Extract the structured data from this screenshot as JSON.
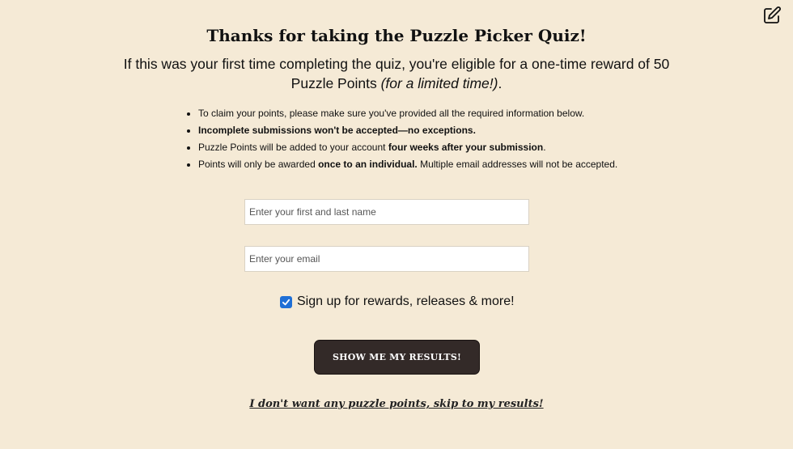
{
  "header": {
    "edit_icon": "edit-square-icon",
    "title": "Thanks for taking the Puzzle Picker Quiz!",
    "subtitle_main": "If this was your first time completing the quiz, you're eligible for a one-time reward of 50 Puzzle Points ",
    "subtitle_italic": "(for a limited time!)",
    "subtitle_end": "."
  },
  "rules": {
    "item1": "To claim your points, please make sure you've provided all the required information below.",
    "item2": "Incomplete submissions won't be accepted—no exceptions.",
    "item3_pre": "Puzzle Points will be added to your account ",
    "item3_bold": "four weeks after your submission",
    "item3_post": ".",
    "item4_pre": "Points will only be awarded ",
    "item4_bold": "once to an individual.",
    "item4_post": " Multiple email addresses will not be accepted."
  },
  "form": {
    "name_placeholder": "Enter your first and last name",
    "name_value": "",
    "email_placeholder": "Enter your email",
    "email_value": "",
    "signup_label": "Sign up for rewards, releases & more!",
    "signup_checked": true,
    "submit_label": "SHOW ME MY RESULTS!",
    "skip_label": "I don't want any puzzle points, skip to my results!"
  },
  "colors": {
    "background": "#f5ead6",
    "button": "#332a28",
    "checkbox": "#1f6fd6"
  }
}
